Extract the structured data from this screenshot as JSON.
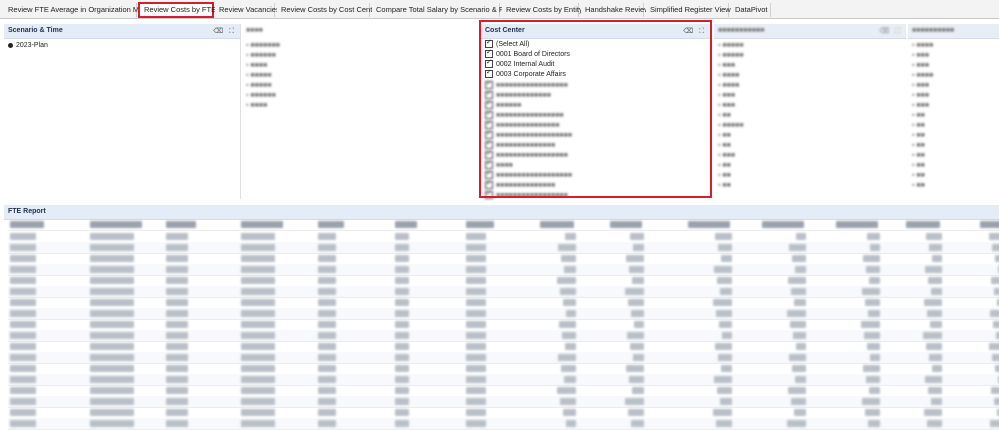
{
  "tabs": [
    {
      "label": "Review FTE Average in Organization Matrix",
      "active": false
    },
    {
      "label": "Review Costs by FTE",
      "active": true
    },
    {
      "label": "Review Vacancies",
      "active": false
    },
    {
      "label": "Review Costs by Cost Center",
      "active": false
    },
    {
      "label": "Compare Total Salary by Scenario & FTE",
      "active": false
    },
    {
      "label": "Review Costs by Entity",
      "active": false
    },
    {
      "label": "Handshake Review",
      "active": false
    },
    {
      "label": "Simplified Register View",
      "active": false
    },
    {
      "label": "DataPivot",
      "active": false
    }
  ],
  "scenario_panel": {
    "title": "Scenario & Time",
    "items": [
      "2023-Plan"
    ]
  },
  "cost_center_panel": {
    "title": "Cost Center",
    "items": [
      {
        "label": "(Select All)",
        "checked": true
      },
      {
        "label": "0001 Board of Directors",
        "checked": true
      },
      {
        "label": "0002 Internal Audit",
        "checked": true
      },
      {
        "label": "0003 Corporate Affairs",
        "checked": true
      }
    ]
  },
  "report": {
    "title": "FTE Report"
  },
  "accent_color": "#d81e2c",
  "header_color": "#e4ecf7"
}
